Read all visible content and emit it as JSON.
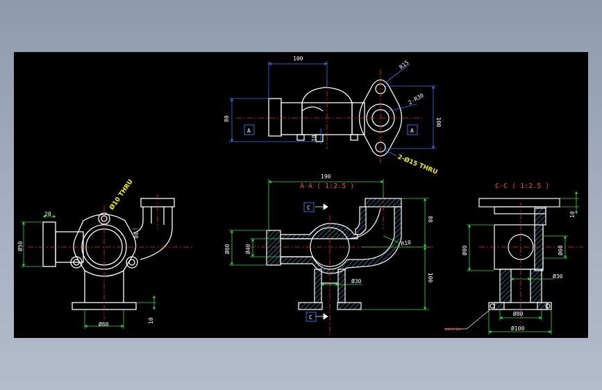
{
  "views": {
    "top": {
      "dim_width": "100",
      "dim_height_left": "80",
      "dim_height_right": "100",
      "dim_small": "10",
      "radius_outer": "R15",
      "radius_inner": "2-R30",
      "holes": "2-Ø15  THRU",
      "section_marker": "A"
    },
    "left": {
      "dim_top": "20",
      "dim_diameter": "Ø50",
      "dim_side": "30",
      "dim_bottom": "Ø60",
      "dim_base": "10",
      "hole": "Ø10 THRU"
    },
    "section_a": {
      "title": "A-A ( 1:2.5 )",
      "dim_width": "190",
      "dim_top": "80",
      "dim_bottom": "100",
      "dim_d60": "Ø60",
      "dim_d40": "Ø40",
      "dim_d30": "Ø30",
      "radius": "R10",
      "section_marker": "C"
    },
    "section_c": {
      "title": "C-C ( 1:2.5 )",
      "dim_top": "10",
      "dim_d80_left": "Ø80",
      "dim_d60": "Ø60",
      "dim_d30": "Ø30",
      "dim_d80_bottom": "Ø80",
      "dim_d100": "Ø100",
      "leader_note": "4HOLES Ø10"
    }
  },
  "colors": {
    "canvas": "#000000",
    "outline": "#ffffff",
    "centerline": "#ff2a2a",
    "dimension": "#2f7fff",
    "dimension_alt": "#28e83c",
    "hatch": "#33c8ff",
    "note": "#f2f200"
  }
}
